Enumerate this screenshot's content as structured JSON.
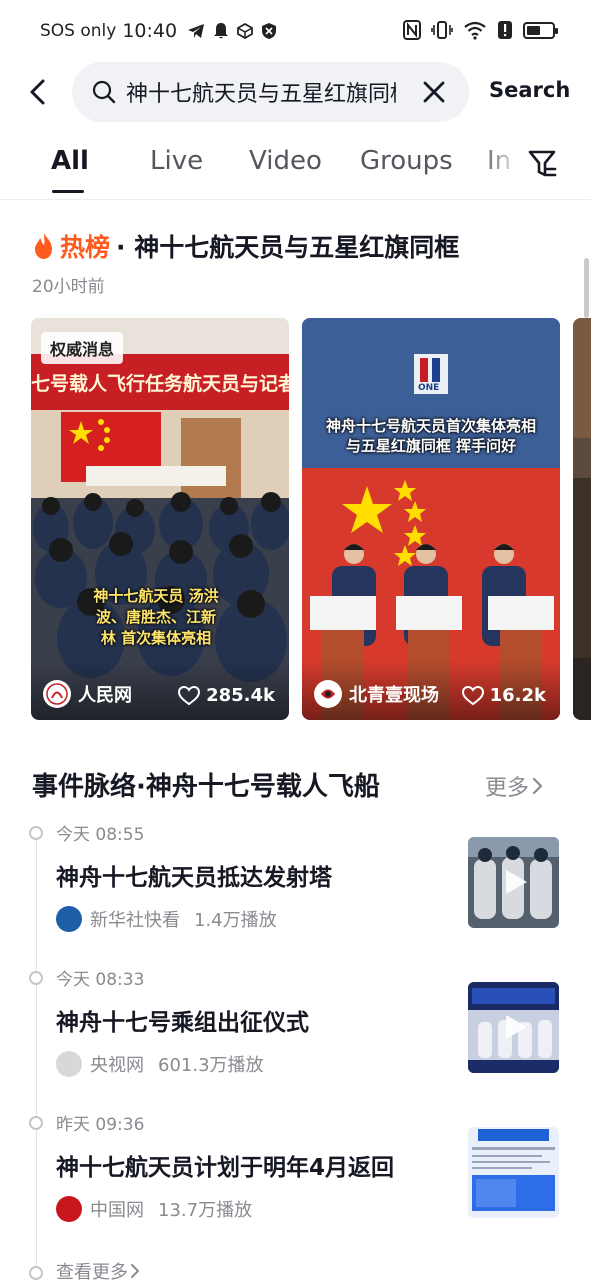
{
  "status_bar": {
    "carrier": "SOS only",
    "time": "10:40",
    "battery_level": 0.55
  },
  "search": {
    "query": "神十七航天员与五星红旗同框",
    "button_label": "Search"
  },
  "tabs": [
    {
      "label": "All",
      "active": true
    },
    {
      "label": "Live",
      "active": false
    },
    {
      "label": "Video",
      "active": false
    },
    {
      "label": "Groups",
      "active": false
    },
    {
      "label": "In",
      "active": false
    }
  ],
  "hot": {
    "tag": "热榜",
    "title": "· 神十七航天员与五星红旗同框",
    "time": "20小时前",
    "cards": [
      {
        "badge": "权威消息",
        "banner": "七号载人飞行任务航天员与记者见面会",
        "caption": "神十七航天员 汤洪波、唐胜杰、江新林 首次集体亮相",
        "author": "人民网",
        "likes": "285.4k"
      },
      {
        "logo_text": "ONE",
        "overlay": "神舟十七号航天员首次集体亮相 与五星红旗同框 挥手问好",
        "author": "北青壹现场",
        "likes": "16.2k"
      }
    ]
  },
  "timeline": {
    "title": "事件脉络·神舟十七号载人飞船",
    "more_label": "更多",
    "items": [
      {
        "time": "今天 08:55",
        "title": "神舟十七航天员抵达发射塔",
        "source": "新华社快看",
        "plays": "1.4万播放",
        "source_color": "#1d5fa8"
      },
      {
        "time": "今天 08:33",
        "title": "神舟十七号乘组出征仪式",
        "source": "央视网",
        "plays": "601.3万播放",
        "source_color": "#d8d8d8"
      },
      {
        "time": "昨天 09:36",
        "title": "神十七航天员计划于明年4月返回",
        "source": "中国网",
        "plays": "13.7万播放",
        "source_color": "#c8161d"
      }
    ],
    "view_more": "查看更多"
  }
}
